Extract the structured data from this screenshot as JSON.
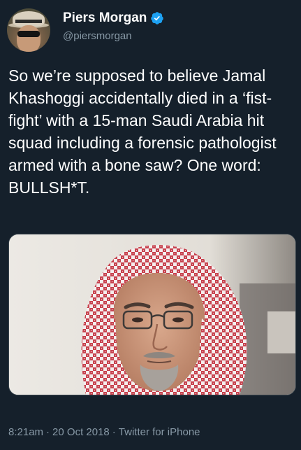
{
  "user": {
    "display_name": "Piers Morgan",
    "handle": "@piersmorgan",
    "verified": true
  },
  "tweet": {
    "text": "So we’re supposed to believe Jamal Khashoggi accidentally died in a ‘fist-fight’ with a 15-man Saudi Arabia hit squad including a forensic pathologist armed with a bone saw? One word: BULLSH*T.",
    "time": "8:21am",
    "date": "20 Oct 2018",
    "source": "Twitter for iPhone",
    "separator": "·"
  },
  "icons": {
    "verified": "verified-badge-icon",
    "avatar": "user-avatar"
  },
  "colors": {
    "background": "#15202b",
    "text_primary": "#ffffff",
    "text_secondary": "#8899a6",
    "verified_blue": "#1da1f2",
    "media_border": "#38444d"
  }
}
